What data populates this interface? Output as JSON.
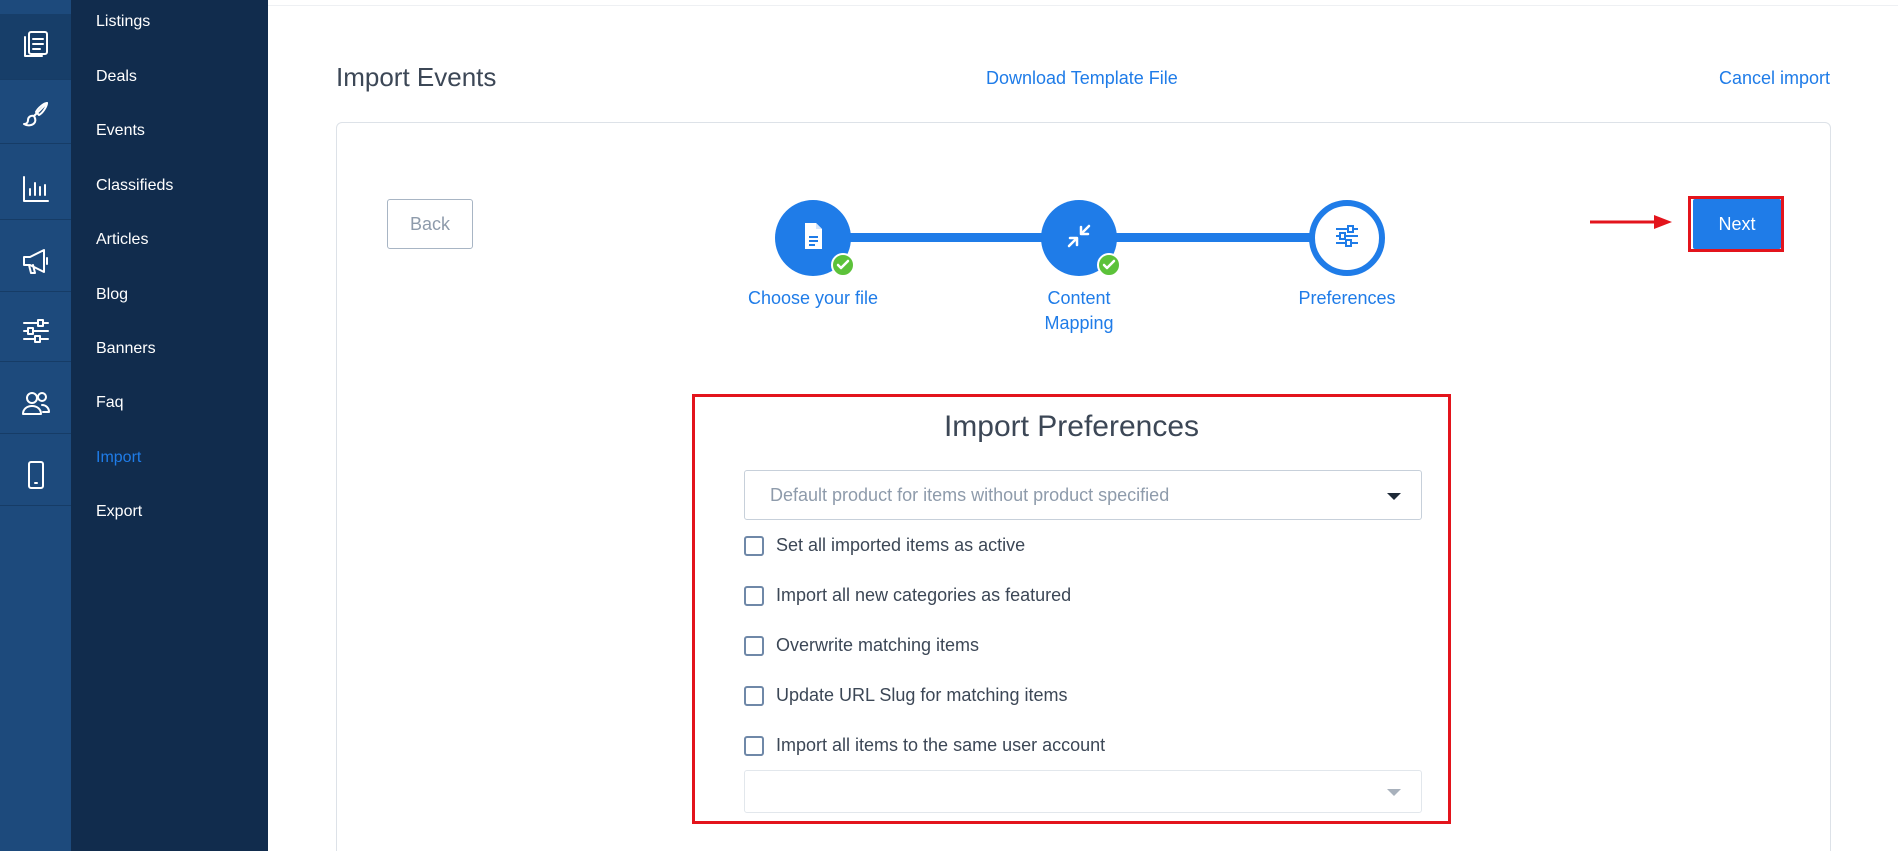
{
  "rail": {
    "items": [
      {
        "icon": "content-icon",
        "active": true
      },
      {
        "icon": "brush-icon",
        "active": false
      },
      {
        "icon": "chart-icon",
        "active": false
      },
      {
        "icon": "megaphone-icon",
        "active": false
      },
      {
        "icon": "sliders-icon",
        "active": false
      },
      {
        "icon": "users-icon",
        "active": false
      },
      {
        "icon": "mobile-icon",
        "active": false
      }
    ]
  },
  "submenu": {
    "items": [
      {
        "label": "Listings"
      },
      {
        "label": "Deals"
      },
      {
        "label": "Events"
      },
      {
        "label": "Classifieds"
      },
      {
        "label": "Articles"
      },
      {
        "label": "Blog"
      },
      {
        "label": "Banners"
      },
      {
        "label": "Faq"
      },
      {
        "label": "Import"
      },
      {
        "label": "Export"
      }
    ],
    "current": "Import"
  },
  "header": {
    "title": "Import Events",
    "download_template": "Download Template File",
    "cancel_import": "Cancel import"
  },
  "buttons": {
    "back": "Back",
    "next": "Next"
  },
  "stepper": {
    "steps": [
      {
        "label": "Choose your file",
        "icon": "file-icon",
        "completed": true
      },
      {
        "label": "Content Mapping",
        "icon": "compress-icon",
        "completed": true
      },
      {
        "label": "Preferences",
        "icon": "sliders-icon",
        "completed": false
      }
    ]
  },
  "preferences": {
    "title": "Import Preferences",
    "default_product_placeholder": "Default product for items without product specified",
    "options": [
      {
        "label": "Set all imported items as active",
        "checked": false
      },
      {
        "label": "Import all new categories as featured",
        "checked": false
      },
      {
        "label": "Overwrite matching items",
        "checked": false
      },
      {
        "label": "Update URL Slug for matching items",
        "checked": false
      },
      {
        "label": "Import all items to the same user account",
        "checked": false
      }
    ],
    "user_account_value": ""
  },
  "colors": {
    "accent": "#1f7ce8",
    "sidebar_dark": "#112c4d",
    "rail": "#1d4a7c",
    "highlight": "#e3141c",
    "success": "#5cc23a"
  }
}
